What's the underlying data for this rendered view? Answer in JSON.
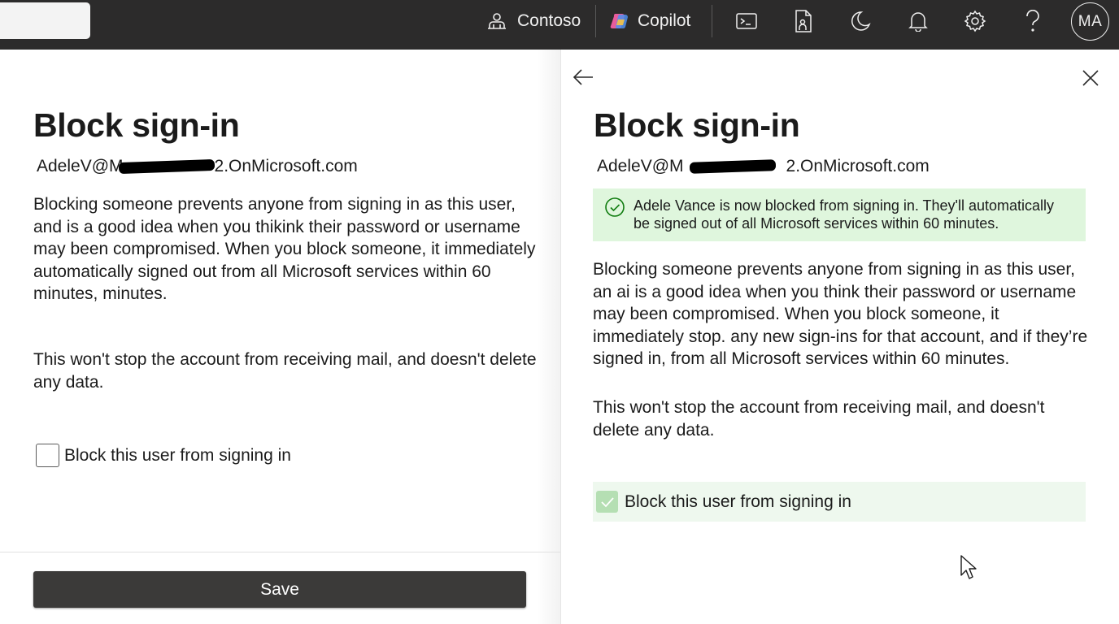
{
  "topbar": {
    "org_label": "Contoso",
    "copilot_label": "Copilot",
    "avatar_initials": "MA",
    "icons": [
      "organization-icon",
      "copilot-icon",
      "terminal-icon",
      "document-icon",
      "moon-icon",
      "bell-icon",
      "gear-icon",
      "help-icon"
    ]
  },
  "left_panel": {
    "title": "Block sign-in",
    "email_prefix": "AdeleV@M",
    "email_suffix": "2.OnMicrosoft.com",
    "paragraph1": "Blocking someone prevents anyone from signing in as this user, and is a good idea when you thikink their password or username may been compromised. When you block someone, it immediately automatically signed out from all Microsoft services within 60 minutes, minutes.",
    "paragraph2": "This won't stop the account from receiving mail, and doesn't delete any data.",
    "checkbox_label": "Block this user from signing in",
    "checkbox_checked": false,
    "save_label": "Save"
  },
  "right_panel": {
    "title": "Block sign-in",
    "email_prefix": "AdeleV@M",
    "email_suffix": "2.OnMicrosoft.com",
    "success_message": "Adele Vance is now blocked from signing in. They'll automatically be signed out of all Microsoft services within 60 minutes.",
    "paragraph1": "Blocking someone prevents anyone from signing in as this user, an ai is a good idea when you think their password or username may been compromised. When you block someone, it immediately stop. any new sign-ins for that account, and if they’re signed in, from all Microsoft services within 60 minutes.",
    "paragraph2": "This won't stop the account from receiving mail, and doesn't delete any data.",
    "checkbox_label": "Block this user from signing in",
    "checkbox_checked": true
  },
  "colors": {
    "topbar_bg": "#2c2b2b",
    "success_bg": "#dff6dd",
    "success_icon": "#107c10",
    "save_button_bg": "#3b3a39"
  }
}
